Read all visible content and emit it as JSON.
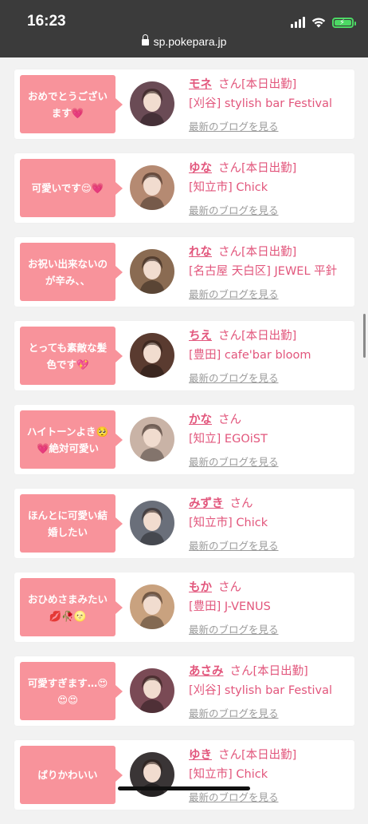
{
  "status": {
    "time": "16:23"
  },
  "browser": {
    "url": "sp.pokepara.jp"
  },
  "colors": {
    "bubble": "#f8939b",
    "accent": "#e2567c",
    "link": "#9a9a9a"
  },
  "list": {
    "items": [
      {
        "message": "おめでとうございます💗",
        "name": "モネ",
        "suffix": "さん[本日出勤]",
        "shop": "[刈谷] stylish bar Festival",
        "blog": "最新のブログを見る",
        "avatar_color": "#6a4b55"
      },
      {
        "message": "可愛いです😌💗",
        "name": "ゆな",
        "suffix": "さん[本日出勤]",
        "shop": "[知立市] Chick",
        "blog": "最新のブログを見る",
        "avatar_color": "#b58a72"
      },
      {
        "message": "お祝い出来ないのが辛み、、",
        "name": "れな",
        "suffix": "さん[本日出勤]",
        "shop": "[名古屋 天白区] JEWEL 平針",
        "blog": "最新のブログを見る",
        "avatar_color": "#8a6b52"
      },
      {
        "message": "とっても素敵な髪色です💖",
        "name": "ちえ",
        "suffix": "さん[本日出勤]",
        "shop": "[豊田] cafe'bar bloom",
        "blog": "最新のブログを見る",
        "avatar_color": "#5a3b30"
      },
      {
        "message": "ハイトーンよき🥺💗絶対可愛い",
        "name": "かな",
        "suffix": "さん",
        "shop": "[知立] EGOiST",
        "blog": "最新のブログを見る",
        "avatar_color": "#c9b3a6"
      },
      {
        "message": "ほんとに可愛い結婚したい",
        "name": "みずき",
        "suffix": "さん",
        "shop": "[知立市] Chick",
        "blog": "最新のブログを見る",
        "avatar_color": "#6a6f7a"
      },
      {
        "message": "おひめさまみたい💋🥀🌝",
        "name": "もか",
        "suffix": "さん",
        "shop": "[豊田] J-VENUS",
        "blog": "最新のブログを見る",
        "avatar_color": "#c9a27f"
      },
      {
        "message": "可愛すぎます…😍😍😍",
        "name": "あさみ",
        "suffix": "さん[本日出勤]",
        "shop": "[刈谷] stylish bar Festival",
        "blog": "最新のブログを見る",
        "avatar_color": "#7a4a55"
      },
      {
        "message": "ばりかわいい",
        "name": "ゆき",
        "suffix": "さん[本日出勤]",
        "shop": "[知立市] Chick",
        "blog": "最新のブログを見る",
        "avatar_color": "#3a3536"
      }
    ]
  }
}
